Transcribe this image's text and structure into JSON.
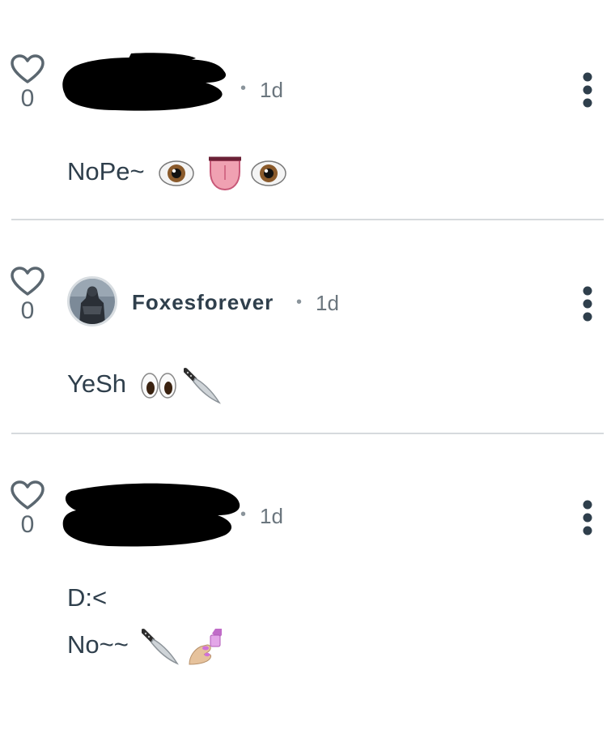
{
  "comments": [
    {
      "likes": "0",
      "author": "",
      "separator": "•",
      "time": "1d",
      "lines": [
        "NoPe~"
      ],
      "emojis": [
        "eye-icon",
        "tongue-icon",
        "eye-icon"
      ]
    },
    {
      "likes": "0",
      "author": "Foxesforever",
      "separator": "•",
      "time": "1d",
      "lines": [
        "YeSh"
      ],
      "emojis": [
        "eyes-icon",
        "knife-icon"
      ]
    },
    {
      "likes": "0",
      "author": "",
      "separator": "•",
      "time": "1d",
      "lines": [
        "D:<",
        "No~~"
      ],
      "emojis": [
        "knife-icon",
        "nail-polish-icon"
      ]
    }
  ],
  "colors": {
    "text": "#2f3f4c",
    "muted": "#6b767e",
    "divider": "#d6dadd",
    "redaction": "#000000"
  }
}
